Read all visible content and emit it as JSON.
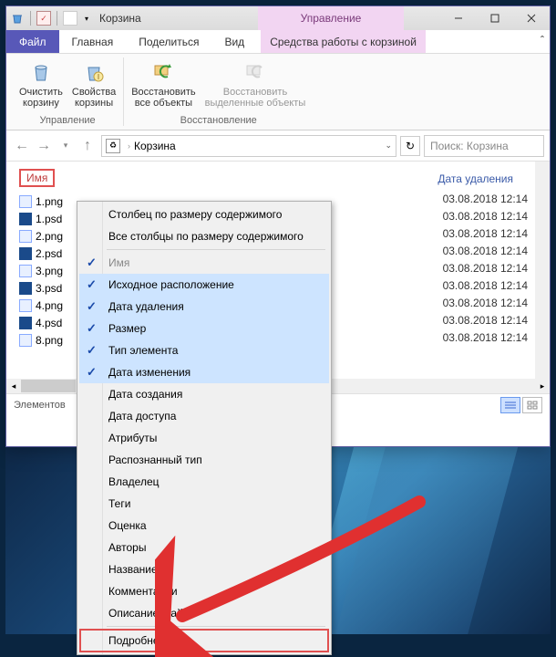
{
  "titlebar": {
    "title": "Корзина",
    "manage": "Управление"
  },
  "tabs": {
    "file": "Файл",
    "home": "Главная",
    "share": "Поделиться",
    "view": "Вид",
    "context": "Средства работы с корзиной"
  },
  "ribbon": {
    "empty": "Очистить\nкорзину",
    "props": "Свойства\nкорзины",
    "restore_all": "Восстановить\nвсе объекты",
    "restore_sel": "Восстановить\nвыделенные объекты",
    "grp_manage": "Управление",
    "grp_restore": "Восстановление"
  },
  "nav": {
    "location": "Корзина",
    "search_placeholder": "Поиск: Корзина"
  },
  "columns": {
    "name": "Имя",
    "date_deleted": "Дата удаления"
  },
  "files": [
    {
      "name": "1.png",
      "type": "png",
      "date": "03.08.2018 12:14"
    },
    {
      "name": "1.psd",
      "type": "psd",
      "date": "03.08.2018 12:14"
    },
    {
      "name": "2.png",
      "type": "png",
      "date": "03.08.2018 12:14"
    },
    {
      "name": "2.psd",
      "type": "psd",
      "date": "03.08.2018 12:14"
    },
    {
      "name": "3.png",
      "type": "png",
      "date": "03.08.2018 12:14"
    },
    {
      "name": "3.psd",
      "type": "psd",
      "date": "03.08.2018 12:14"
    },
    {
      "name": "4.png",
      "type": "png",
      "date": "03.08.2018 12:14"
    },
    {
      "name": "4.psd",
      "type": "psd",
      "date": "03.08.2018 12:14"
    },
    {
      "name": "8.png",
      "type": "png",
      "date": "03.08.2018 12:14"
    }
  ],
  "status": {
    "text": "Элементов"
  },
  "ctx": {
    "size_col": "Столбец по размеру содержимого",
    "size_all": "Все столбцы по размеру содержимого",
    "name": "Имя",
    "orig_loc": "Исходное расположение",
    "date_del": "Дата удаления",
    "size": "Размер",
    "type": "Тип элемента",
    "date_mod": "Дата изменения",
    "date_created": "Дата создания",
    "date_access": "Дата доступа",
    "attrs": "Атрибуты",
    "perceived": "Распознанный тип",
    "owner": "Владелец",
    "tags": "Теги",
    "rating": "Оценка",
    "authors": "Авторы",
    "title": "Название",
    "comments": "Комментарии",
    "file_desc": "Описание файла",
    "more": "Подробнее..."
  }
}
